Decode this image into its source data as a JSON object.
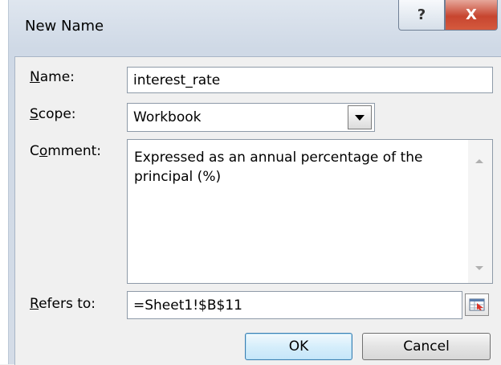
{
  "dialog": {
    "title": "New Name",
    "help_glyph": "?",
    "close_glyph": "X"
  },
  "form": {
    "name": {
      "label_underline": "N",
      "label_rest": "ame:",
      "value": "interest_rate"
    },
    "scope": {
      "label_underline": "S",
      "label_rest": "cope:",
      "value": "Workbook"
    },
    "comment": {
      "label_pre": "C",
      "label_underline": "o",
      "label_rest": "mment:",
      "value": "Expressed as an annual percentage of the principal (%)"
    },
    "refers_to": {
      "label_underline": "R",
      "label_rest": "efers to:",
      "value": "=Sheet1!$B$11"
    }
  },
  "buttons": {
    "ok": "OK",
    "cancel": "Cancel"
  },
  "icons": {
    "help": "help-icon",
    "close": "close-icon",
    "dropdown": "chevron-down-icon",
    "collapse": "range-collapse-icon"
  }
}
